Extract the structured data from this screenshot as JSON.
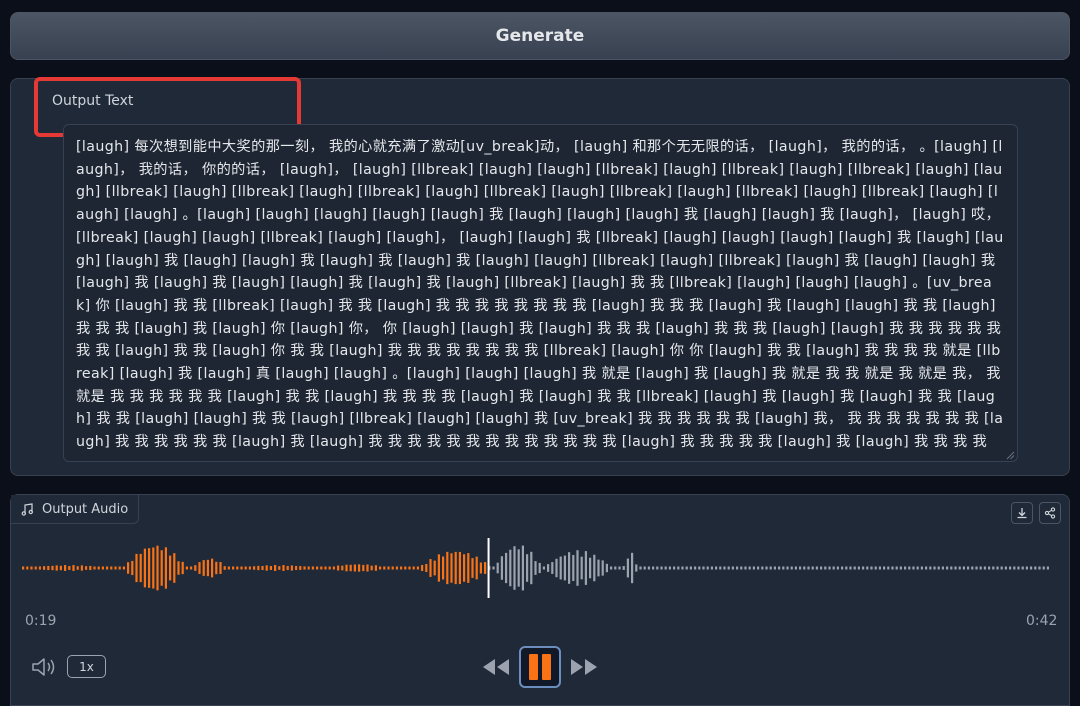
{
  "generate": {
    "label": "Generate"
  },
  "output_text": {
    "label": "Output Text",
    "value": "[laugh] 每次想到能中大奖的那一刻， 我的心就充满了激动[uv_break]动， [laugh] 和那个无无限的话， [laugh]， 我的的话， 。[laugh] [laugh]， 我的话， 你的的话， [laugh]， [laugh] [llbreak] [laugh] [laugh] [llbreak] [laugh] [llbreak] [laugh] [llbreak] [laugh] [laugh] [llbreak] [laugh] [llbreak] [laugh] [llbreak] [laugh] [llbreak] [laugh] [llbreak] [laugh] [llbreak] [laugh] [llbreak] [laugh] [laugh] [laugh] 。[laugh] [laugh] [laugh] [laugh] [laugh] 我 [laugh] [laugh] [laugh] 我 [laugh] [laugh] 我 [laugh]， [laugh] 哎， [llbreak] [laugh] [laugh] [llbreak] [laugh] [laugh]， [laugh] [laugh] 我 [llbreak] [laugh] [laugh] [laugh] [laugh] 我 [laugh] [laugh] [laugh] 我 [laugh] [laugh] 我 [laugh] 我 [laugh] 我 [laugh] [laugh] [llbreak] [laugh] [llbreak] [laugh] 我 [laugh] [laugh] 我 [laugh] 我 [laugh] 我 [laugh] [laugh] 我 [laugh] 我 [laugh] [llbreak] [laugh] 我 我 [llbreak] [laugh] [laugh] [laugh] 。[uv_break] 你 [laugh] 我 我 [llbreak] [laugh] 我 我 [laugh] 我 我 我 我 我 我 我 我 [laugh] 我 我 我 [laugh] 我 [laugh] [laugh] 我 我 [laugh] 我 我 我 [laugh] 我 [laugh] 你 [laugh] 你， 你 [laugh] [laugh] 我 [laugh] 我 我 我 [laugh] 我 我 我 [laugh] [laugh] 我 我 我 我 我 我 我 我 [laugh] 我 我 [laugh] 你 我 我 [laugh] 我 我 我 我 我 我 我 我 [llbreak] [laugh] 你 你 [laugh] 我 我 [laugh] 我 我 我 我 就是 [llbreak] [laugh] 我 [laugh] 真 [laugh] [laugh] 。[laugh] [laugh] [laugh] 我 就是 [laugh] 我 [laugh] 我 就是 我 我 就是 我 就是 我， 我 就是 我 我 我 我 我 我 [laugh] 我 我 [laugh] 我 我 我 我 [laugh] 我 [laugh] 我 我 [llbreak] [laugh] 我 [laugh] 我 [laugh] 我 我 [laugh] 我 我 [laugh] [laugh] 我 我 [laugh] [llbreak] [laugh] [laugh] 我 [uv_break] 我 我 我 我 我 我 [laugh] 我， 我 我 我 我 我 我 我 [laugh] 我 我 我 我 我 我 [laugh] 我 [laugh] 我 我 我 我 我 我 我 我 我 我 我 我 我 [laugh] 我 我 我 我 我 [laugh] 我 [laugh] 我 我 我 我"
  },
  "output_audio": {
    "label": "Output Audio",
    "current_time": "0:19",
    "duration": "0:42",
    "progress": 0.452,
    "speed": "1x"
  },
  "icons": {
    "music": "music-note-icon",
    "download": "download-icon",
    "share": "share-icon",
    "volume": "volume-icon",
    "rewind": "rewind-icon",
    "pause": "pause-icon",
    "forward": "fast-forward-icon"
  },
  "colors": {
    "played": "#f97316",
    "unplayed": "#9ca3af",
    "highlight": "#e53935"
  }
}
